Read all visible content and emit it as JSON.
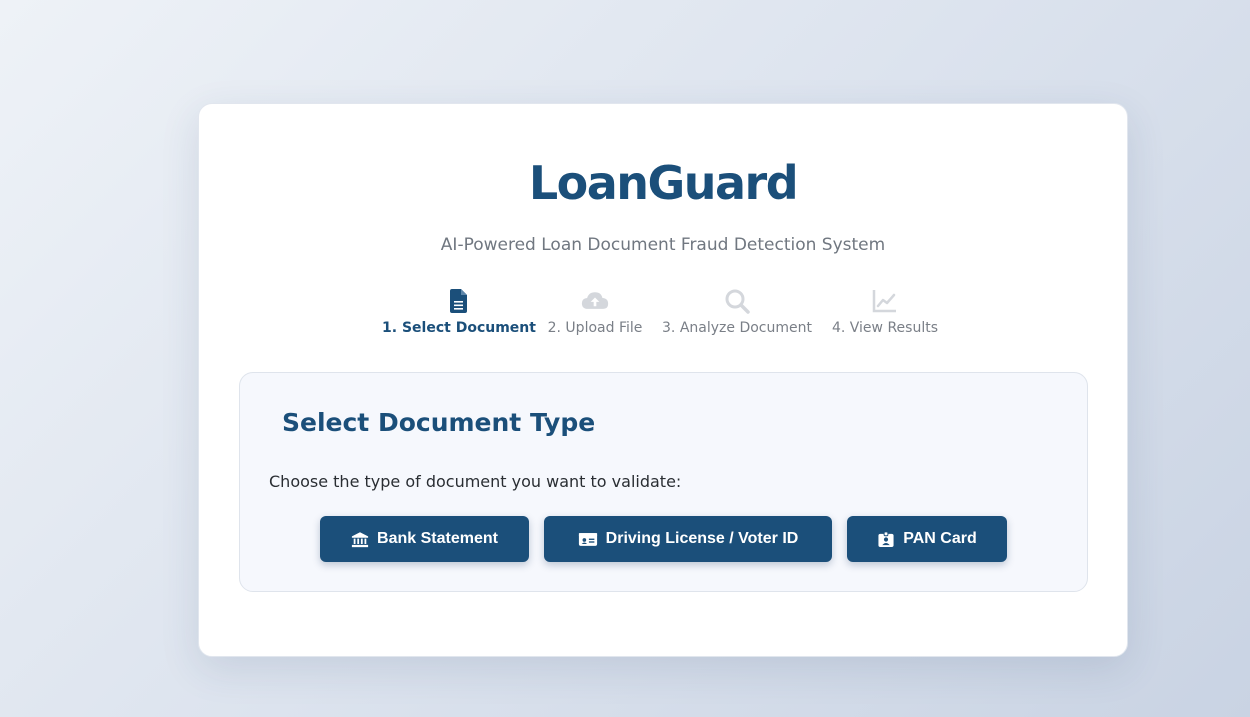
{
  "header": {
    "title": "LoanGuard",
    "subtitle": "AI-Powered Loan Document Fraud Detection System"
  },
  "steps": [
    {
      "label": "1. Select Document",
      "icon": "file-text-icon",
      "active": true
    },
    {
      "label": "2. Upload File",
      "icon": "cloud-upload-icon",
      "active": false
    },
    {
      "label": "3. Analyze Document",
      "icon": "search-icon",
      "active": false
    },
    {
      "label": "4. View Results",
      "icon": "line-chart-icon",
      "active": false
    }
  ],
  "panel": {
    "title": "Select Document Type",
    "instruction": "Choose the type of document you want to validate:",
    "buttons": [
      {
        "label": "Bank Statement",
        "icon": "bank-icon"
      },
      {
        "label": "Driving License / Voter ID",
        "icon": "id-card-icon"
      },
      {
        "label": "PAN Card",
        "icon": "id-badge-icon"
      }
    ]
  },
  "colors": {
    "brand": "#1b4f7a",
    "inactive_icon": "#d4d7dc",
    "muted_text": "#7a7f87"
  }
}
